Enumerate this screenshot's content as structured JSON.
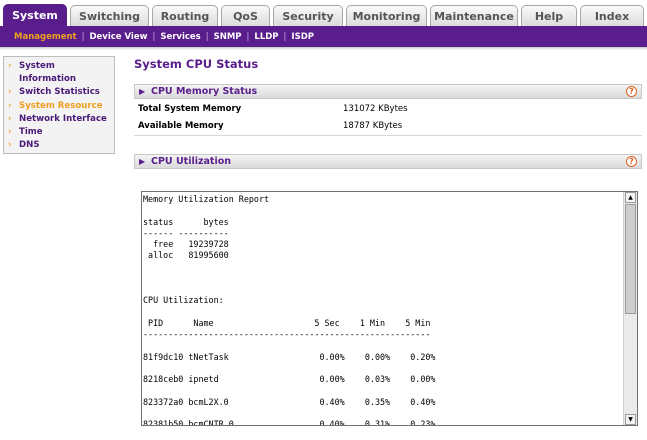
{
  "top_tabs": [
    {
      "label": "System",
      "active": true
    },
    {
      "label": "Switching",
      "active": false
    },
    {
      "label": "Routing",
      "active": false
    },
    {
      "label": "QoS",
      "active": false
    },
    {
      "label": "Security",
      "active": false
    },
    {
      "label": "Monitoring",
      "active": false
    },
    {
      "label": "Maintenance",
      "active": false
    },
    {
      "label": "Help",
      "active": false
    },
    {
      "label": "Index",
      "active": false
    }
  ],
  "sub_nav": [
    {
      "label": "Management",
      "active": true
    },
    {
      "label": "Device View",
      "active": false
    },
    {
      "label": "Services",
      "active": false
    },
    {
      "label": "SNMP",
      "active": false
    },
    {
      "label": "LLDP",
      "active": false
    },
    {
      "label": "ISDP",
      "active": false
    }
  ],
  "sub_nav_separator": "|",
  "left_nav": [
    {
      "label": "System Information",
      "active": false
    },
    {
      "label": "Switch Statistics",
      "active": false
    },
    {
      "label": "System Resource",
      "active": true
    },
    {
      "label": "Network Interface",
      "active": false
    },
    {
      "label": "Time",
      "active": false
    },
    {
      "label": "DNS",
      "active": false
    }
  ],
  "left_nav_marker": "›",
  "page_title": "System CPU Status",
  "memory_section": {
    "label": "CPU Memory Status",
    "rows": [
      {
        "key": "Total System Memory",
        "value": "131072 KBytes"
      },
      {
        "key": "Available Memory",
        "value": "18787 KBytes"
      }
    ]
  },
  "utilization_section": {
    "label": "CPU Utilization"
  },
  "help_icon_glyph": "?",
  "section_arrow_glyph": "▶",
  "report_text": "Memory Utilization Report\n\nstatus      bytes\n------ ----------\n  free   19239728\n alloc   81995600\n\n\n\nCPU Utilization:\n\n PID      Name                    5 Sec    1 Min    5 Min\n---------------------------------------------------------\n\n81f9dc10 tNetTask                  0.00%    0.00%    0.20%\n\n8218ceb0 ipnetd                    0.00%    0.03%    0.00%\n\n823372a0 bcmL2X.0                  0.40%    0.35%    0.40%\n\n82381b50 bcmCNTR.0                 0.40%    0.31%    0.23%",
  "scrollbar": {
    "up_glyph": "▲",
    "down_glyph": "▼"
  },
  "colors": {
    "brand_purple": "#5a1e8c",
    "accent_orange": "#f0a020",
    "help_orange": "#e06020"
  }
}
